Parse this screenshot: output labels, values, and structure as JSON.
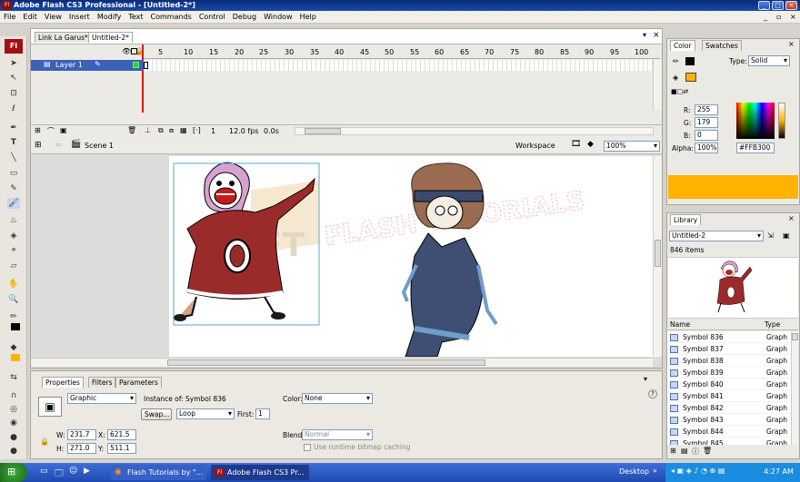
{
  "titlebar": {
    "title": "Adobe Flash CS3 Professional - [Untitled-2*]",
    "app_icon": "Fl"
  },
  "menu": [
    "File",
    "Edit",
    "View",
    "Insert",
    "Modify",
    "Text",
    "Commands",
    "Control",
    "Debug",
    "Window",
    "Help"
  ],
  "doc_tabs": [
    "Link La Garus*",
    "Untitled-2*"
  ],
  "timeline": {
    "frame_numbers": [
      "5",
      "10",
      "15",
      "20",
      "25",
      "30",
      "35",
      "40",
      "45",
      "50",
      "55",
      "60",
      "65",
      "70",
      "75",
      "80",
      "85",
      "90",
      "95",
      "100"
    ],
    "layer_name": "Layer 1",
    "current_frame": "1",
    "fps": "12.0 fps",
    "time": "0.0s"
  },
  "stage": {
    "scene": "Scene 1",
    "workspace": "Workspace",
    "zoom": "100%",
    "watermark": "FLASH TUTORIALS"
  },
  "properties": {
    "tabs": [
      "Properties",
      "Filters",
      "Parameters"
    ],
    "symbol_type": "Graphic",
    "instance_of_label": "Instance of:",
    "instance_of_value": "Symbol 836",
    "swap_label": "Swap...",
    "loop_value": "Loop",
    "first_label": "First:",
    "first_value": "1",
    "color_label": "Color:",
    "color_value": "None",
    "blend_label": "Blend:",
    "blend_value": "Normal",
    "cache_label": "Use runtime bitmap caching",
    "w_label": "W:",
    "w_value": "231.7",
    "h_label": "H:",
    "h_value": "271.0",
    "x_label": "X:",
    "x_value": "621.5",
    "y_label": "Y:",
    "y_value": "511.1"
  },
  "color_panel": {
    "tabs": [
      "Color",
      "Swatches"
    ],
    "type_label": "Type:",
    "type_value": "Solid",
    "r_label": "R:",
    "r_value": "255",
    "g_label": "G:",
    "g_value": "179",
    "b_label": "B:",
    "b_value": "0",
    "alpha_label": "Alpha:",
    "alpha_value": "100%",
    "hex_value": "#FFB300",
    "fill_color": "#FFB300"
  },
  "library": {
    "tab": "Library",
    "document": "Untitled-2",
    "item_count": "846 items",
    "col_name": "Name",
    "col_type": "Type",
    "items": [
      {
        "name": "Symbol 836",
        "type": "Graph"
      },
      {
        "name": "Symbol 837",
        "type": "Graph"
      },
      {
        "name": "Symbol 838",
        "type": "Graph"
      },
      {
        "name": "Symbol 839",
        "type": "Graph"
      },
      {
        "name": "Symbol 840",
        "type": "Graph"
      },
      {
        "name": "Symbol 841",
        "type": "Graph"
      },
      {
        "name": "Symbol 842",
        "type": "Graph"
      },
      {
        "name": "Symbol 843",
        "type": "Graph"
      },
      {
        "name": "Symbol 844",
        "type": "Graph"
      },
      {
        "name": "Symbol 845",
        "type": "Graph"
      }
    ]
  },
  "taskbar": {
    "start": "start",
    "tasks": [
      "Flash Tutorials by \"...",
      "Adobe Flash CS3 Pr..."
    ],
    "desktop": "Desktop",
    "clock": "4:27 AM"
  }
}
